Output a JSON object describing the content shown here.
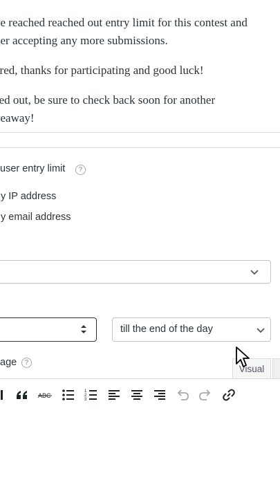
{
  "messages": {
    "limit_line1": "ve reached reached out entry limit for this contest and",
    "limit_line2": "ger accepting any more submissions.",
    "entered": "ered, thanks for participating and good luck!",
    "closed_line1": "sed out, be sure to check back soon for another",
    "closed_line2": "veaway!"
  },
  "settings": {
    "entry_limit_label": "user entry limit",
    "by_ip_label": "y IP address",
    "by_email_label": "y email address",
    "period_select_value": "till the end of the day",
    "message_label": "age"
  },
  "editor": {
    "tab_visual": "Visual"
  },
  "icons": {
    "help": "?",
    "blockquote": "blockquote-icon",
    "strikethrough": "strikethrough-icon"
  },
  "colors": {
    "accent": "#2c3338",
    "border": "#c3c4c7"
  }
}
